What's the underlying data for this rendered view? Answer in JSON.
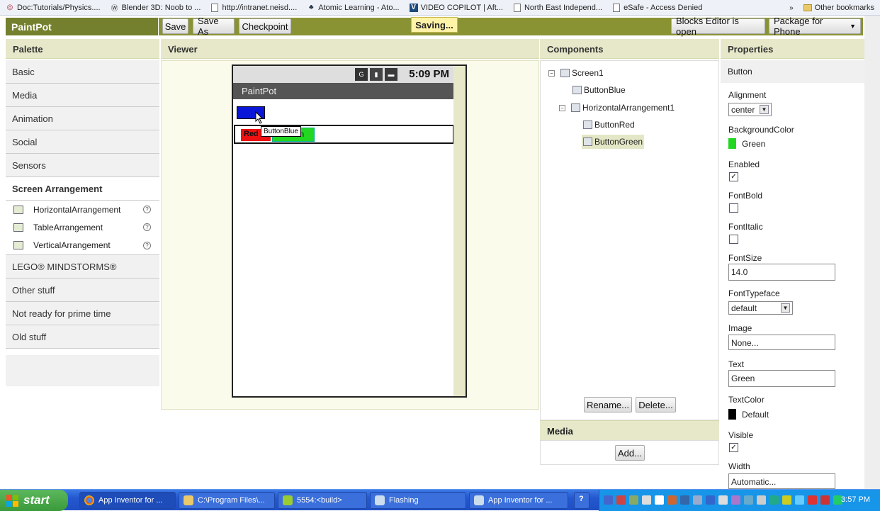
{
  "bookmarks": [
    {
      "label": "Doc:Tutorials/Physics....",
      "icon": "globe-icon"
    },
    {
      "label": "Blender 3D: Noob to ...",
      "icon": "wiki-icon"
    },
    {
      "label": "http://intranet.neisd....",
      "icon": "page-icon"
    },
    {
      "label": "Atomic Learning - Ato...",
      "icon": "atomic-icon"
    },
    {
      "label": "VIDEO COPILOT | Aft...",
      "icon": "v-icon"
    },
    {
      "label": "North East Independ...",
      "icon": "page-icon"
    },
    {
      "label": "eSafe - Access Denied",
      "icon": "page-icon"
    }
  ],
  "bookmarks_other": "Other bookmarks",
  "app": {
    "title": "PaintPot",
    "save": "Save",
    "save_as": "Save As",
    "checkpoint": "Checkpoint",
    "saving": "Saving...",
    "blocks_editor": "Blocks Editor is open",
    "package": "Package for Phone"
  },
  "palette": {
    "header": "Palette",
    "categories_top": [
      "Basic",
      "Media",
      "Animation",
      "Social",
      "Sensors"
    ],
    "active_category": "Screen Arrangement",
    "items": [
      "HorizontalArrangement",
      "TableArrangement",
      "VerticalArrangement"
    ],
    "help": "?",
    "categories_bottom": [
      "LEGO® MINDSTORMS®",
      "Other stuff",
      "Not ready for prime time",
      "Old stuff"
    ]
  },
  "viewer": {
    "header": "Viewer",
    "clock": "5:09 PM",
    "screen_title": "PaintPot",
    "btn_red_label": "Red",
    "btn_green_label": "n",
    "tooltip": "ButtonBlue"
  },
  "components": {
    "header": "Components",
    "tree": {
      "screen": "Screen1",
      "button_blue": "ButtonBlue",
      "harr": "HorizontalArrangement1",
      "button_red": "ButtonRed",
      "button_green": "ButtonGreen"
    },
    "toggle": "⊟",
    "rename": "Rename...",
    "delete": "Delete..."
  },
  "media": {
    "header": "Media",
    "add": "Add..."
  },
  "properties": {
    "header": "Properties",
    "component": "Button",
    "alignment_label": "Alignment",
    "alignment_value": "center",
    "bgcolor_label": "BackgroundColor",
    "bgcolor_value": "Green",
    "bgcolor_hex": "#22d622",
    "enabled_label": "Enabled",
    "enabled": true,
    "fontbold_label": "FontBold",
    "fontbold": false,
    "fontitalic_label": "FontItalic",
    "fontitalic": false,
    "fontsize_label": "FontSize",
    "fontsize_value": "14.0",
    "typeface_label": "FontTypeface",
    "typeface_value": "default",
    "image_label": "Image",
    "image_value": "None...",
    "text_label": "Text",
    "text_value": "Green",
    "textcolor_label": "TextColor",
    "textcolor_value": "Default",
    "textcolor_hex": "#000000",
    "visible_label": "Visible",
    "visible": true,
    "width_label": "Width",
    "width_value": "Automatic..."
  },
  "taskbar": {
    "start": "start",
    "tasks": [
      {
        "label": "App Inventor for ...",
        "icon": "chrome-icon"
      },
      {
        "label": "C:\\Program Files\\...",
        "icon": "folder-icon"
      },
      {
        "label": "5554:<build>",
        "icon": "android-icon"
      },
      {
        "label": "Flashing",
        "icon": "window-icon"
      },
      {
        "label": "App Inventor for ...",
        "icon": "window-icon"
      }
    ],
    "help_icon": "?",
    "clock": "3:57 PM"
  },
  "colors": {
    "accent": "#8a9334",
    "header": "#e6e8c9",
    "blue_button": "#0a17d8",
    "red_button": "#ee1111",
    "green_button": "#22d622"
  }
}
